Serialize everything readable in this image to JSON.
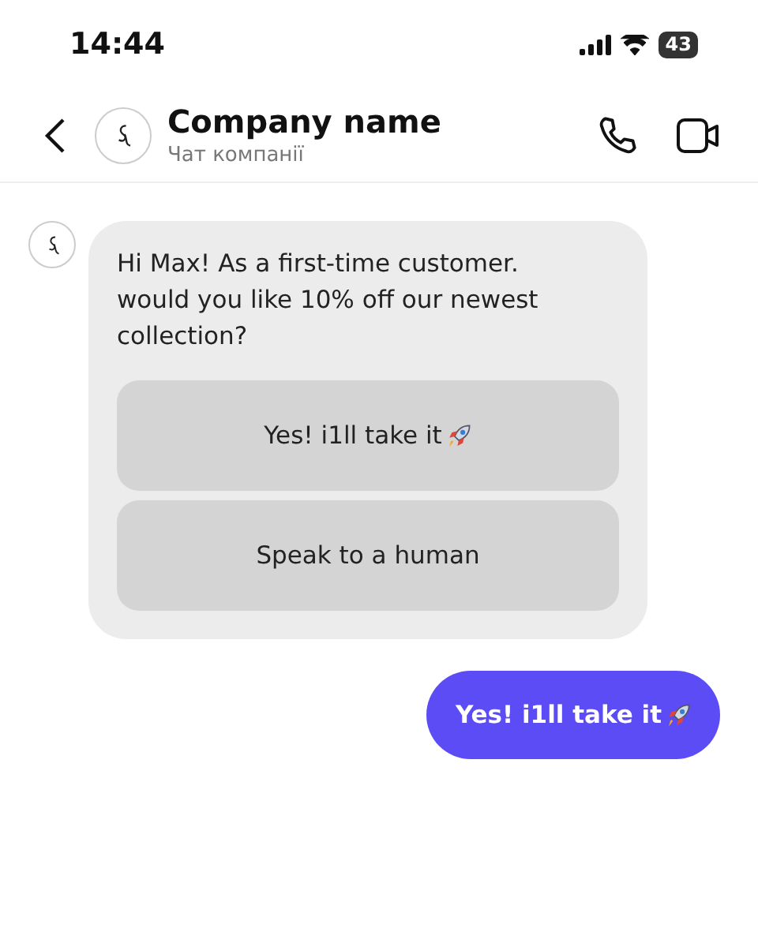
{
  "status_bar": {
    "time": "14:44",
    "battery": "43"
  },
  "header": {
    "title": "Company name",
    "subtitle": "Чат компанії"
  },
  "messages": [
    {
      "kind": "incoming",
      "text": "Hi Max! As a  first-time customer. would you like 10% off our newest collection?",
      "options": [
        {
          "label": "Yes! i1ll take it",
          "rocket": true
        },
        {
          "label": "Speak to a human",
          "rocket": false
        }
      ]
    },
    {
      "kind": "outgoing",
      "text": "Yes! i1ll take it",
      "rocket": true
    }
  ]
}
